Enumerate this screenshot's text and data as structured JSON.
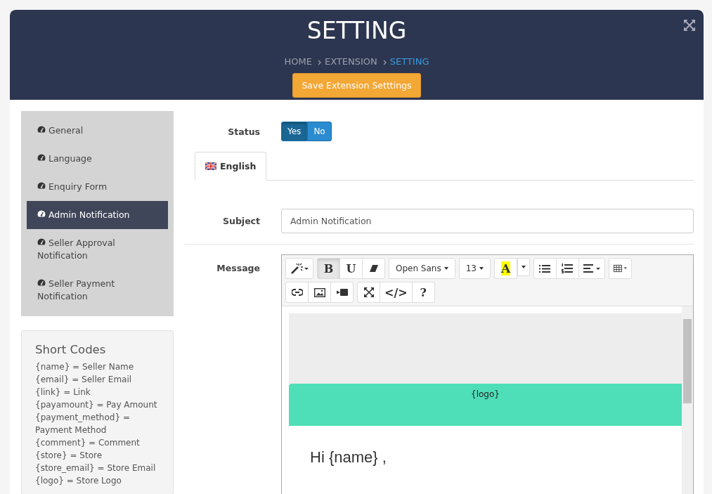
{
  "header": {
    "title": "SETTING",
    "breadcrumb": [
      {
        "label": "HOME",
        "selected": false
      },
      {
        "label": "EXTENSION",
        "selected": false
      },
      {
        "label": "SETTING",
        "selected": true
      }
    ],
    "save_button": "Save Extension Setttings"
  },
  "sidebar": {
    "items": [
      {
        "label": "General",
        "selected": false
      },
      {
        "label": "Language",
        "selected": false
      },
      {
        "label": "Enquiry Form",
        "selected": false
      },
      {
        "label": "Admin Notification",
        "selected": true
      },
      {
        "label": "Seller Approval Notification",
        "selected": false
      },
      {
        "label": "Seller Payment Notification",
        "selected": false
      }
    ]
  },
  "short_codes": {
    "title": "Short Codes",
    "lines": [
      "{name} = Seller Name",
      "{email} = Seller Email",
      "{link} = Link",
      "{payamount} = Pay Amount",
      "{payment_method} = Payment Method",
      "{comment} = Comment",
      "{store} = Store",
      "{store_email} = Store Email",
      "{logo} = Store Logo"
    ]
  },
  "form": {
    "status": {
      "label": "Status",
      "options": [
        {
          "label": "Yes",
          "selected": true
        },
        {
          "label": "No",
          "selected": false
        }
      ]
    },
    "tabs": [
      {
        "label": "English",
        "selected": true
      }
    ],
    "subject": {
      "label": "Subject",
      "value": "Admin Notification"
    },
    "message": {
      "label": "Message",
      "toolbar": [
        [
          {
            "kind": "wand"
          }
        ],
        [
          {
            "kind": "text",
            "label": "B",
            "active": true
          },
          {
            "kind": "text",
            "label": "U",
            "active": false
          },
          {
            "kind": "eraser"
          }
        ],
        [
          {
            "kind": "dropdown",
            "label": "Open Sans"
          }
        ],
        [
          {
            "kind": "dropdown",
            "label": "13"
          }
        ],
        [
          {
            "kind": "highlight",
            "label": "A"
          },
          {
            "kind": "caret"
          }
        ],
        [
          {
            "kind": "ul"
          },
          {
            "kind": "ol"
          },
          {
            "kind": "align"
          }
        ],
        [
          {
            "kind": "table"
          }
        ],
        [
          {
            "kind": "link"
          },
          {
            "kind": "image"
          },
          {
            "kind": "video"
          }
        ],
        [
          {
            "kind": "fullscreen"
          },
          {
            "kind": "text",
            "label": "</>",
            "active": false
          },
          {
            "kind": "text",
            "label": "?",
            "active": false
          }
        ]
      ],
      "logo_banner": "{logo}",
      "greeting": "Hi {name} ,"
    }
  }
}
